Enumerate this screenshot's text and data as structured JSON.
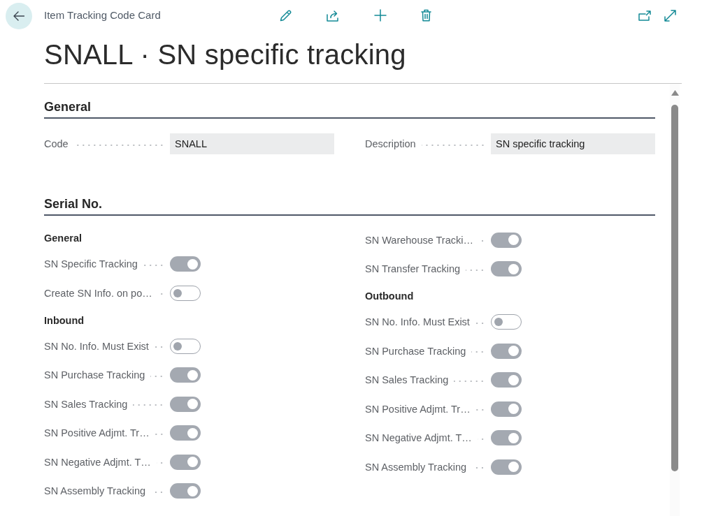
{
  "header": {
    "caption": "Item Tracking Code Card"
  },
  "title": "SNALL · SN specific tracking",
  "sections": [
    {
      "kind": "fields",
      "title": "General",
      "fields": [
        {
          "label": "Code",
          "value": "SNALL"
        },
        {
          "label": "Description",
          "value": "SN specific tracking"
        }
      ]
    },
    {
      "kind": "toggles",
      "title": "Serial No.",
      "columns": [
        {
          "items": [
            {
              "kind": "heading",
              "text": "General"
            },
            {
              "kind": "toggle",
              "label": "SN Specific Tracking",
              "on": true
            },
            {
              "kind": "toggle",
              "label": "Create SN Info. on po…",
              "on": false
            },
            {
              "kind": "heading",
              "text": "Inbound"
            },
            {
              "kind": "toggle",
              "label": "SN No. Info. Must Exist",
              "on": false
            },
            {
              "kind": "toggle",
              "label": "SN Purchase Tracking",
              "on": true
            },
            {
              "kind": "toggle",
              "label": "SN Sales Tracking",
              "on": true
            },
            {
              "kind": "toggle",
              "label": "SN Positive Adjmt. Tr…",
              "on": true
            },
            {
              "kind": "toggle",
              "label": "SN Negative Adjmt. T…",
              "on": true
            },
            {
              "kind": "toggle",
              "label": "SN Assembly Tracking",
              "on": true
            }
          ]
        },
        {
          "items": [
            {
              "kind": "toggle",
              "label": "SN Warehouse Tracki…",
              "on": true
            },
            {
              "kind": "toggle",
              "label": "SN Transfer Tracking",
              "on": true
            },
            {
              "kind": "heading",
              "text": "Outbound"
            },
            {
              "kind": "toggle",
              "label": "SN No. Info. Must Exist",
              "on": false
            },
            {
              "kind": "toggle",
              "label": "SN Purchase Tracking",
              "on": true
            },
            {
              "kind": "toggle",
              "label": "SN Sales Tracking",
              "on": true
            },
            {
              "kind": "toggle",
              "label": "SN Positive Adjmt. Tr…",
              "on": true
            },
            {
              "kind": "toggle",
              "label": "SN Negative Adjmt. T…",
              "on": true
            },
            {
              "kind": "toggle",
              "label": "SN Assembly Tracking",
              "on": true
            }
          ]
        }
      ]
    }
  ]
}
